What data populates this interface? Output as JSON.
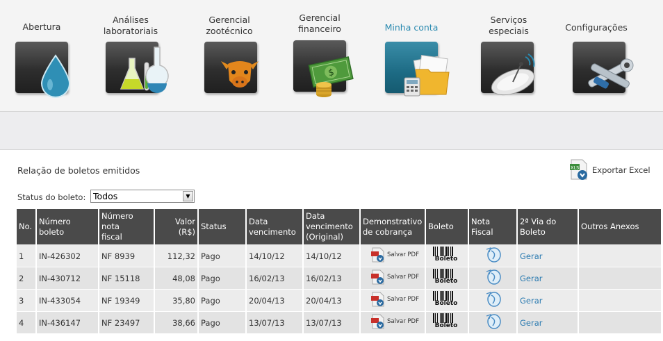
{
  "nav": {
    "items": [
      {
        "id": "abertura",
        "lines": [
          "Abertura"
        ],
        "icon": "water-drop-icon"
      },
      {
        "id": "analises",
        "lines": [
          "Análises",
          "laboratoriais"
        ],
        "icon": "lab-flask-icon"
      },
      {
        "id": "zootecnico",
        "lines": [
          "Gerencial",
          "zootécnico"
        ],
        "icon": "cow-head-icon"
      },
      {
        "id": "financeiro",
        "lines": [
          "Gerencial",
          "financeiro"
        ],
        "icon": "money-icon"
      },
      {
        "id": "minhaconta",
        "lines": [
          "Minha conta"
        ],
        "icon": "folder-documents-icon",
        "active": true
      },
      {
        "id": "servicos",
        "lines": [
          "Serviços",
          "especiais"
        ],
        "icon": "satellite-dish-icon"
      },
      {
        "id": "configuracoes",
        "lines": [
          "Configurações"
        ],
        "icon": "tools-icon"
      }
    ]
  },
  "page": {
    "title": "Relação de boletos emitidos",
    "export_label": "Exportar Excel"
  },
  "filter": {
    "label": "Status do boleto:",
    "selected": "Todos"
  },
  "table": {
    "headers": {
      "no": "No.",
      "numero_boleto": "Número boleto",
      "numero_nota_1": "Número nota",
      "numero_nota_2": "fiscal",
      "valor": "Valor (R$)",
      "status": "Status",
      "data_venc_1": "Data",
      "data_venc_2": "vencimento",
      "data_orig_1": "Data",
      "data_orig_2": "vencimento",
      "data_orig_3": "(Original)",
      "demo_1": "Demonstrativo",
      "demo_2": "de cobrança",
      "boleto": "Boleto",
      "nota_fiscal": "Nota Fiscal",
      "via_1": "2ª Via do",
      "via_2": "Boleto",
      "outros": "Outros Anexos"
    },
    "pdf_label": "Salvar PDF",
    "barcode_label": "Boleto",
    "rows": [
      {
        "no": "1",
        "boleto": "IN-426302",
        "nota": "NF 8939",
        "valor": "112,32",
        "status": "Pago",
        "vencimento": "14/10/12",
        "original": "14/10/12",
        "via": "Gerar"
      },
      {
        "no": "2",
        "boleto": "IN-430712",
        "nota": "NF 15118",
        "valor": "48,08",
        "status": "Pago",
        "vencimento": "16/02/13",
        "original": "16/02/13",
        "via": "Gerar"
      },
      {
        "no": "3",
        "boleto": "IN-433054",
        "nota": "NF 19349",
        "valor": "35,80",
        "status": "Pago",
        "vencimento": "20/04/13",
        "original": "20/04/13",
        "via": "Gerar"
      },
      {
        "no": "4",
        "boleto": "IN-436147",
        "nota": "NF 23497",
        "valor": "38,66",
        "status": "Pago",
        "vencimento": "13/07/13",
        "original": "13/07/13",
        "via": "Gerar"
      }
    ]
  }
}
